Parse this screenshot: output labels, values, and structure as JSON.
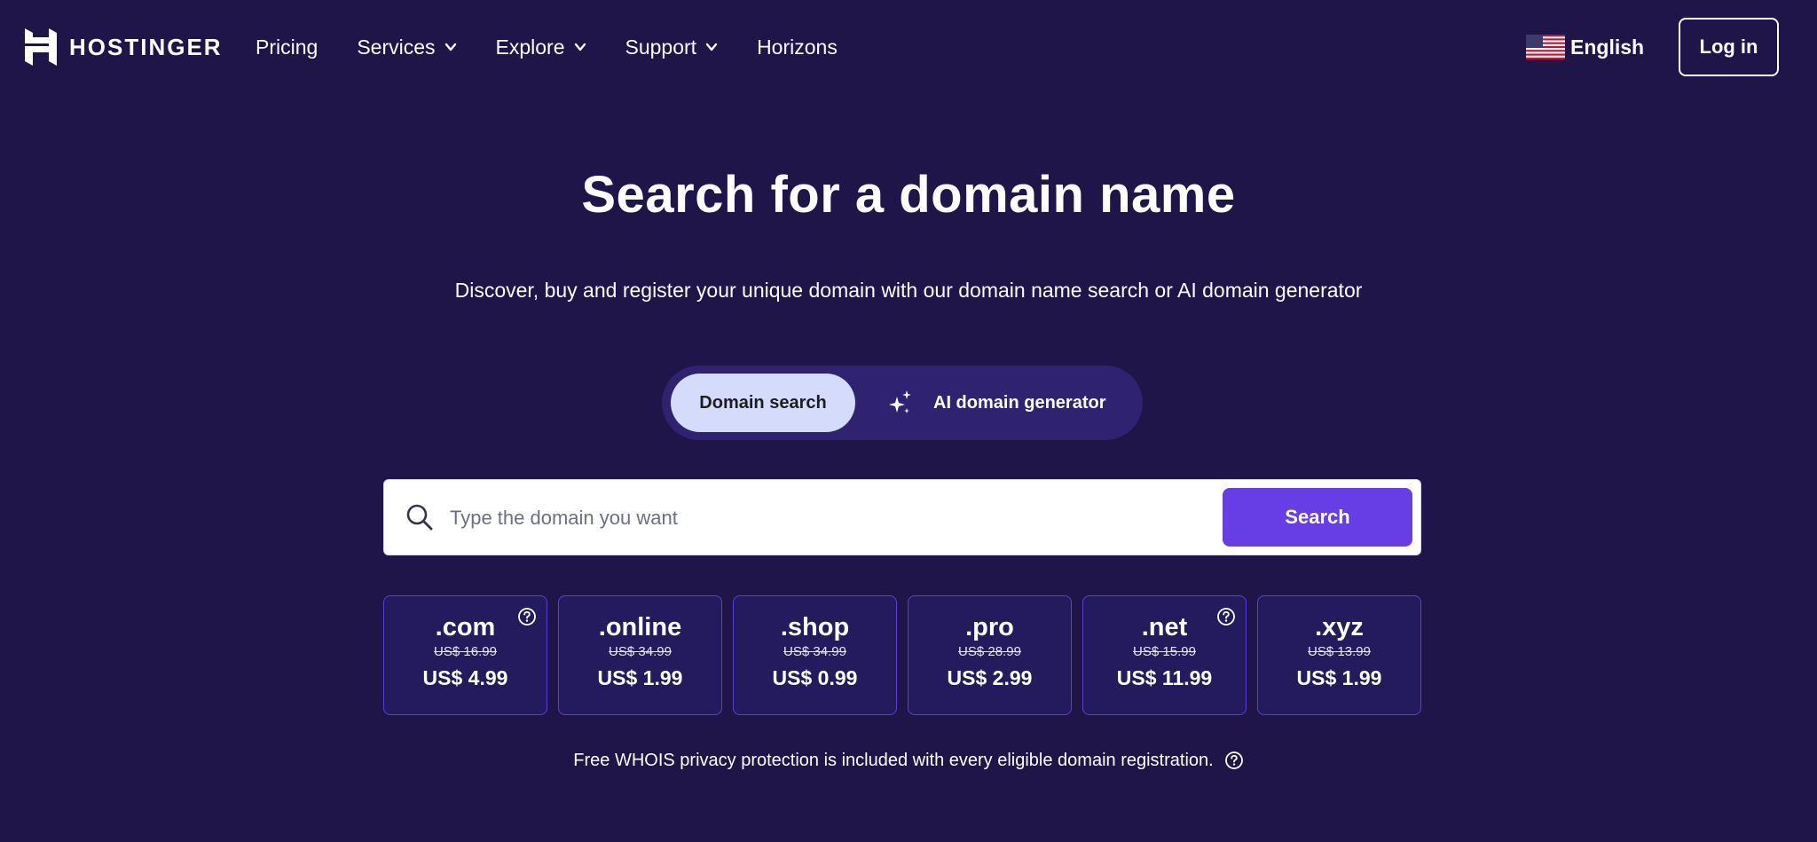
{
  "brand": {
    "name": "HOSTINGER"
  },
  "nav": {
    "items": [
      {
        "label": "Pricing",
        "has_dropdown": false
      },
      {
        "label": "Services",
        "has_dropdown": true
      },
      {
        "label": "Explore",
        "has_dropdown": true
      },
      {
        "label": "Support",
        "has_dropdown": true
      },
      {
        "label": "Horizons",
        "has_dropdown": false
      }
    ],
    "language": {
      "label": "English",
      "flag_icon": "us-flag-icon"
    },
    "login_label": "Log in"
  },
  "hero": {
    "title": "Search for a domain name",
    "subtitle": "Discover, buy and register your unique domain with our domain name search or AI domain generator"
  },
  "tabs": {
    "active_label": "Domain search",
    "ai_label": "AI domain generator",
    "ai_icon": "sparkle-icon"
  },
  "search": {
    "placeholder": "Type the domain you want",
    "value": "",
    "button_label": "Search",
    "icon": "search-icon"
  },
  "domains": [
    {
      "tld": ".com",
      "old_price": "US$ 16.99",
      "price": "US$ 4.99",
      "has_help": true
    },
    {
      "tld": ".online",
      "old_price": "US$ 34.99",
      "price": "US$ 1.99",
      "has_help": false
    },
    {
      "tld": ".shop",
      "old_price": "US$ 34.99",
      "price": "US$ 0.99",
      "has_help": false
    },
    {
      "tld": ".pro",
      "old_price": "US$ 28.99",
      "price": "US$ 2.99",
      "has_help": false
    },
    {
      "tld": ".net",
      "old_price": "US$ 15.99",
      "price": "US$ 11.99",
      "has_help": true
    },
    {
      "tld": ".xyz",
      "old_price": "US$ 13.99",
      "price": "US$ 1.99",
      "has_help": false
    }
  ],
  "note": {
    "text": "Free WHOIS privacy protection is included with every eligible domain registration."
  },
  "colors": {
    "background": "#1f1548",
    "accent": "#673de6",
    "tab_active_bg": "#d5dbfb",
    "tab_bar_bg": "#2f2270",
    "card_border": "#5b3fd9"
  }
}
